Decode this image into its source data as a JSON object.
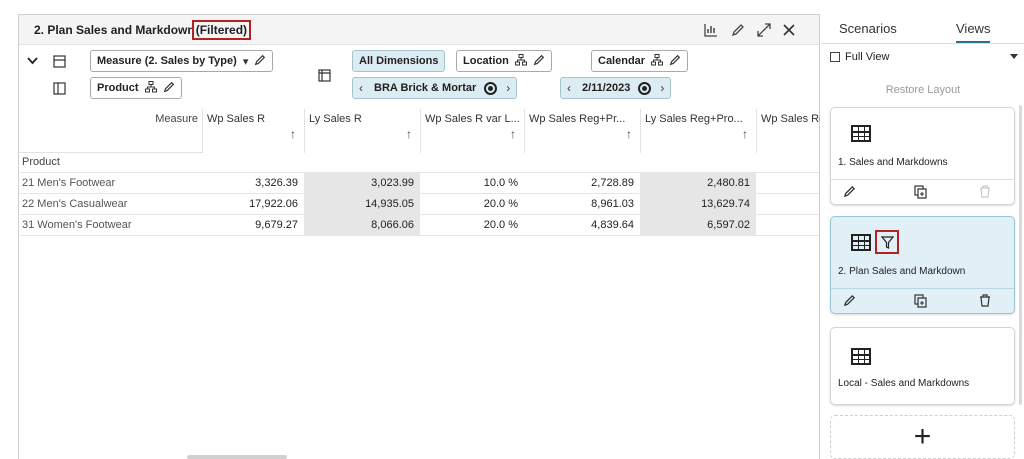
{
  "view": {
    "title": "2. Plan Sales and Markdown",
    "filtered_label": "(Filtered)"
  },
  "controls": {
    "measure_label": "Measure (2. Sales by Type)",
    "product_label": "Product",
    "all_dimensions_label": "All Dimensions",
    "location_label": "Location",
    "calendar_label": "Calendar",
    "location_value": "BRA Brick & Mortar",
    "calendar_value": "2/11/2023"
  },
  "grid": {
    "measure_header": "Measure",
    "product_header": "Product",
    "columns": [
      "Wp Sales R",
      "Ly Sales R",
      "Wp Sales R var L...",
      "Wp Sales Reg+Pr...",
      "Ly Sales Reg+Pro...",
      "Wp Sales Re"
    ],
    "rows": [
      {
        "name": "21 Men's Footwear",
        "values": [
          "3,326.39",
          "3,023.99",
          "10.0 %",
          "2,728.89",
          "2,480.81"
        ]
      },
      {
        "name": "22 Men's Casualwear",
        "values": [
          "17,922.06",
          "14,935.05",
          "20.0 %",
          "8,961.03",
          "13,629.74"
        ]
      },
      {
        "name": "31 Women's Footwear",
        "values": [
          "9,679.27",
          "8,066.06",
          "20.0 %",
          "4,839.64",
          "6,597.02"
        ]
      }
    ]
  },
  "side_panel": {
    "tabs": [
      "Scenarios",
      "Views"
    ],
    "active_tab": "Views",
    "full_view_label": "Full View",
    "restore_label": "Restore Layout",
    "cards": [
      {
        "label": "1. Sales and Markdowns",
        "selected": false
      },
      {
        "label": "2. Plan Sales and Markdown",
        "selected": true
      },
      {
        "label": "Local - Sales and Markdowns",
        "selected": false
      }
    ],
    "add_label": "+"
  },
  "colors": {
    "highlight_box": "#b32121",
    "selected_card": "#e0f0f6",
    "control_blue": "#dcecf3",
    "grey_cell": "#e6e6e6"
  }
}
